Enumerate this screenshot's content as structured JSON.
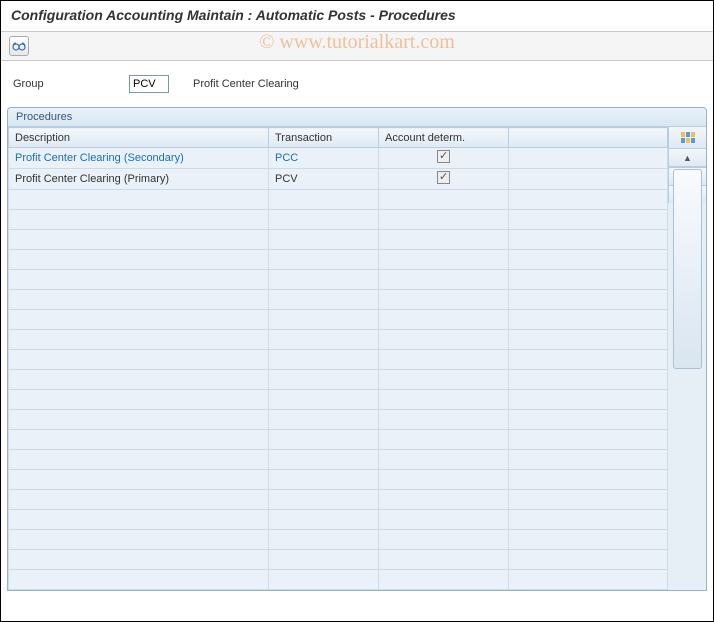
{
  "title": "Configuration Accounting Maintain : Automatic Posts - Procedures",
  "watermark": "© www.tutorialkart.com",
  "group": {
    "label": "Group",
    "value": "PCV",
    "desc": "Profit Center Clearing"
  },
  "panel": {
    "title": "Procedures",
    "columns": {
      "description": "Description",
      "transaction": "Transaction",
      "account": "Account determ."
    },
    "rows": [
      {
        "description": "Profit Center Clearing (Secondary)",
        "transaction": "PCC",
        "account_checked": true,
        "is_link": true
      },
      {
        "description": "Profit Center Clearing (Primary)",
        "transaction": "PCV",
        "account_checked": true,
        "is_link": false
      }
    ],
    "empty_rows": 20
  }
}
